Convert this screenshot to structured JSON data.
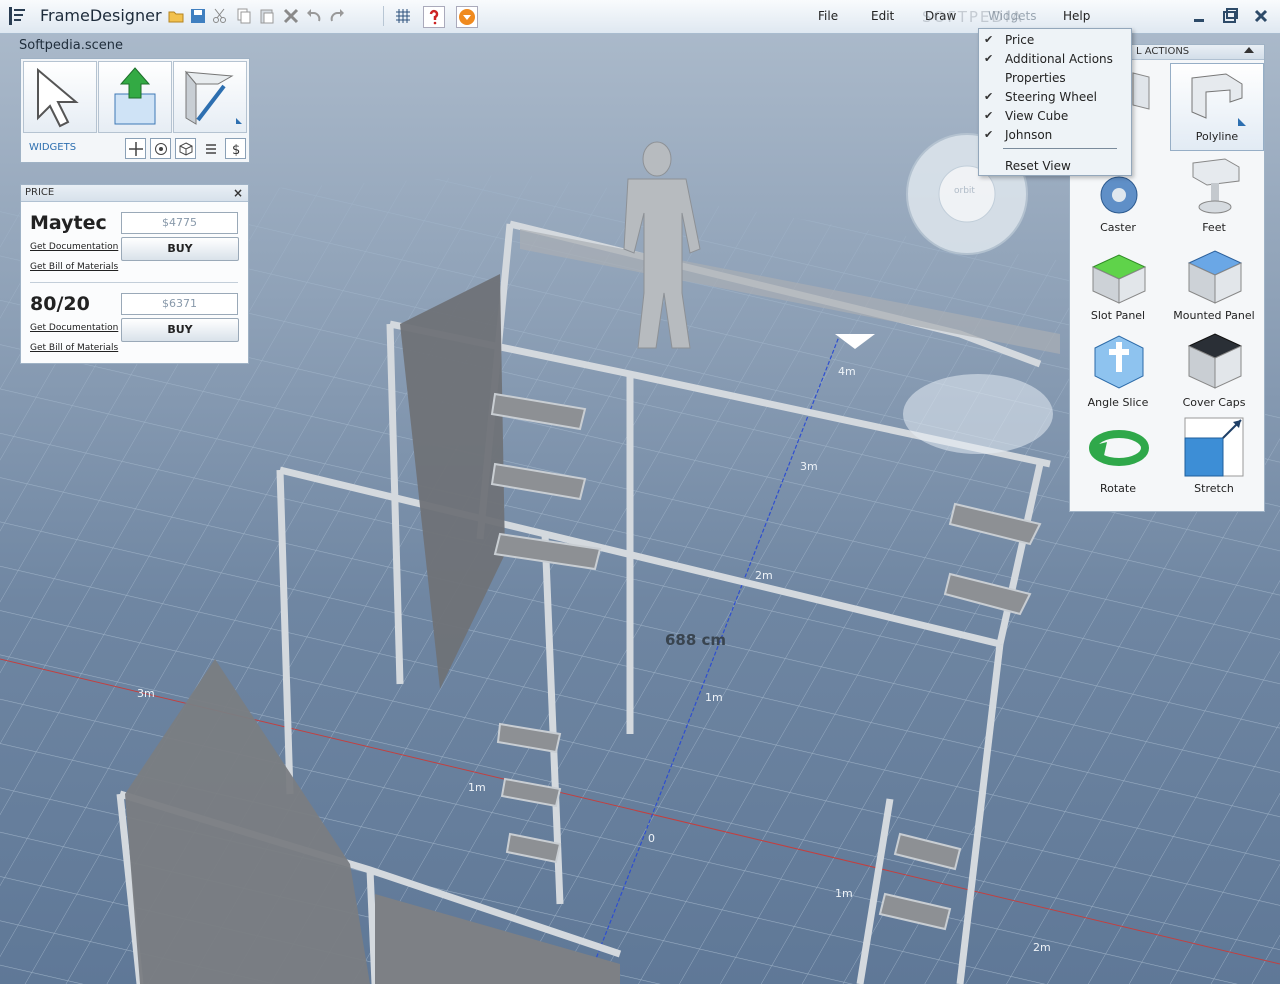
{
  "app": {
    "title": "FrameDesigner",
    "scene_name": "Softpedia.scene",
    "watermark": "SOFTPEDIA"
  },
  "menu": {
    "file": "File",
    "edit": "Edit",
    "draw": "Draw",
    "widgets": "Widgets",
    "help": "Help"
  },
  "toolbar": {
    "icons": [
      "open-folder-icon",
      "save-icon",
      "cut-icon",
      "copy-icon",
      "paste-icon",
      "delete-icon",
      "undo-icon",
      "redo-icon",
      "grid-icon",
      "help-question-icon",
      "dropdown-icon"
    ]
  },
  "tools": {
    "widgets_label": "WIDGETS",
    "big": [
      "select-arrow-icon",
      "insert-component-icon",
      "profile-tool-icon"
    ],
    "small": [
      "move-icon",
      "orbit-icon",
      "cube-icon",
      "list-icon",
      "dollar-icon"
    ]
  },
  "price": {
    "header": "PRICE",
    "close": "×",
    "vendors": [
      {
        "name": "Maytec",
        "price": "$4775",
        "buy": "BUY",
        "doc": "Get Documentation",
        "bom": "Get Bill of Materials"
      },
      {
        "name": "80/20",
        "price": "$6371",
        "buy": "BUY",
        "doc": "Get Documentation",
        "bom": "Get Bill of Materials"
      }
    ]
  },
  "actions": {
    "header": "L ACTIONS",
    "items": [
      {
        "label": "Polyline"
      },
      {
        "label": "Caster"
      },
      {
        "label": "Feet"
      },
      {
        "label": "Slot Panel"
      },
      {
        "label": "Mounted Panel"
      },
      {
        "label": "Angle Slice"
      },
      {
        "label": "Cover Caps"
      },
      {
        "label": "Rotate"
      },
      {
        "label": "Stretch"
      }
    ]
  },
  "widgets_menu": {
    "items": [
      {
        "label": "Price",
        "checked": true
      },
      {
        "label": "Additional Actions",
        "checked": true
      },
      {
        "label": "Properties",
        "checked": false
      },
      {
        "label": "Steering Wheel",
        "checked": true
      },
      {
        "label": "View Cube",
        "checked": true
      },
      {
        "label": "Johnson",
        "checked": true
      }
    ],
    "reset": "Reset View",
    "check": "✔"
  },
  "steering_wheel": {
    "center": "orbit"
  },
  "viewport": {
    "measure": "688 cm",
    "dims": [
      "4m",
      "3m",
      "2m",
      "1m",
      "0",
      "3m",
      "1m",
      "1m",
      "2m"
    ]
  },
  "colors": {
    "accent": "#2d6fb0",
    "grid": "#5f7897",
    "frame": "#c8cdd2"
  }
}
